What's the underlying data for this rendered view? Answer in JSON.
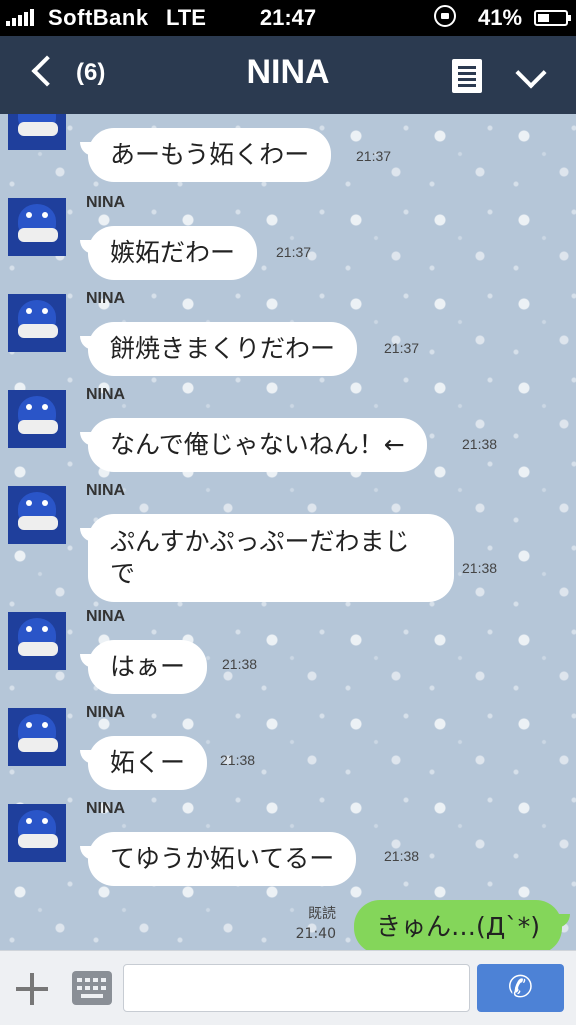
{
  "status": {
    "carrier": "SoftBank",
    "network": "LTE",
    "time": "21:47",
    "battery": "41%",
    "battery_level": 0.41,
    "icons": [
      "signal-icon",
      "rotation-lock-icon",
      "battery-icon"
    ]
  },
  "header": {
    "back_count": "(6)",
    "title": "NINA",
    "icons": [
      "back-chevron-icon",
      "notes-icon",
      "chevron-down-icon"
    ]
  },
  "messages": [
    {
      "sender": "NINA",
      "text": "あーもう妬くわー",
      "time": "21:37"
    },
    {
      "sender": "NINA",
      "text": "嫉妬だわー",
      "time": "21:37"
    },
    {
      "sender": "NINA",
      "text": "餅焼きまくりだわー",
      "time": "21:37"
    },
    {
      "sender": "NINA",
      "text": "なんで俺じゃないねん！←",
      "time": "21:38"
    },
    {
      "sender": "NINA",
      "text": "ぷんすかぷっぷーだわまじで",
      "time": "21:38"
    },
    {
      "sender": "NINA",
      "text": "はぁー",
      "time": "21:38"
    },
    {
      "sender": "NINA",
      "text": "妬くー",
      "time": "21:38"
    },
    {
      "sender": "NINA",
      "text": "てゆうか妬いてるー",
      "time": "21:38"
    }
  ],
  "own_message": {
    "read": "既読",
    "time": "21:40",
    "text": "きゅん…(Д`*)"
  },
  "input": {
    "placeholder": "",
    "icons": [
      "plus-icon",
      "keyboard-icon",
      "phone-icon"
    ]
  }
}
